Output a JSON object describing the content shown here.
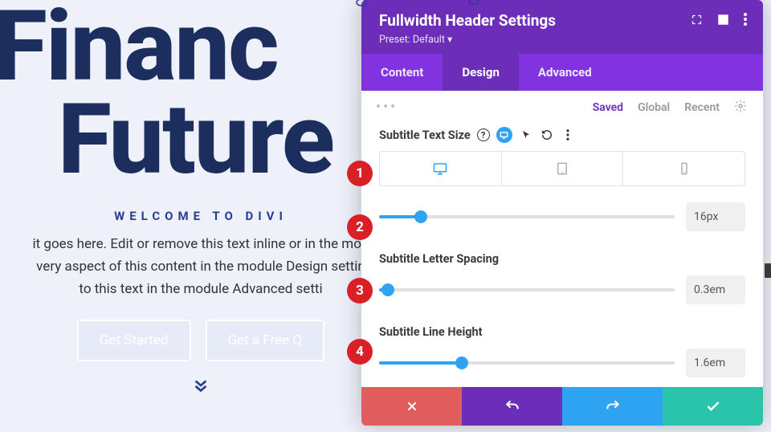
{
  "page": {
    "hero_line1": "Financ",
    "hero_line2": "Future",
    "subtitle": "Welcome to Divi",
    "body_l1": "it goes here. Edit or remove this text inline or in the mod",
    "body_l2": "very aspect of this content in the module Design settin",
    "body_l3": "to this text in the module Advanced setti",
    "cta1": "Get Started",
    "cta2": "Get a Free Q"
  },
  "panel": {
    "title": "Fullwidth Header Settings",
    "preset": "Preset: Default",
    "tabs": {
      "content": "Content",
      "design": "Design",
      "advanced": "Advanced"
    },
    "subbar": {
      "saved": "Saved",
      "global": "Global",
      "recent": "Recent"
    }
  },
  "fields": {
    "subtitle_size": {
      "label": "Subtitle Text Size",
      "value": "16px",
      "pct": 14
    },
    "letter_spacing": {
      "label": "Subtitle Letter Spacing",
      "value": "0.3em",
      "pct": 3
    },
    "line_height": {
      "label": "Subtitle Line Height",
      "value": "1.6em",
      "pct": 28
    }
  },
  "anno": {
    "1": "1",
    "2": "2",
    "3": "3",
    "4": "4"
  }
}
